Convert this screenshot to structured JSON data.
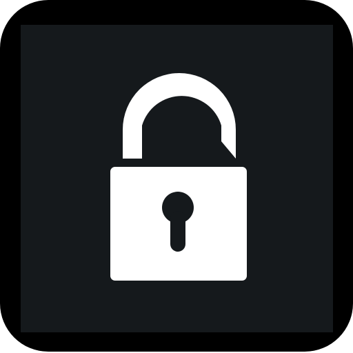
{
  "icon": {
    "name": "unlocked-padlock-icon",
    "colors": {
      "frame": "#000000",
      "background": "#15191c",
      "glyph": "#ffffff"
    }
  }
}
